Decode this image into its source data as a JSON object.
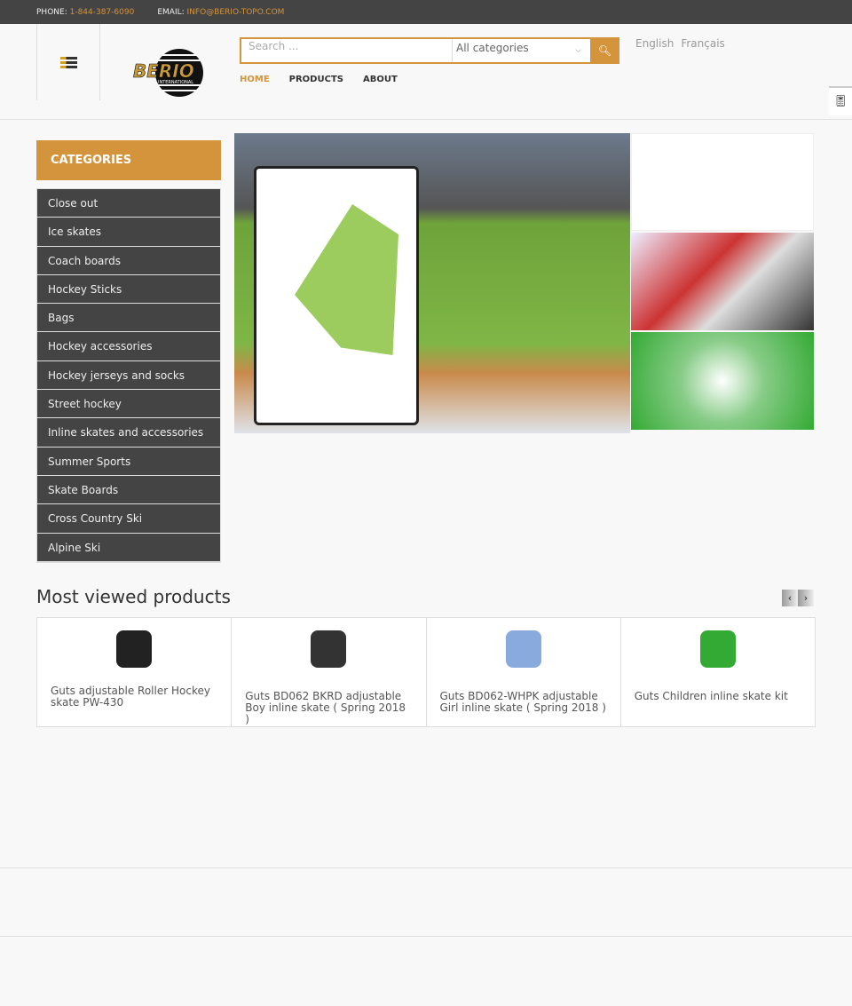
{
  "topbar": {
    "phone_label": "PHONE:",
    "phone": "1-844-387-6090",
    "email_label": "EMAIL:",
    "email": "INFO@BERIO-TOPO.COM"
  },
  "logo": {
    "text": "BERIO",
    "sub": "INTERNATIONAL"
  },
  "search": {
    "placeholder": "Search ...",
    "category": "All categories"
  },
  "languages": [
    "English",
    "Français"
  ],
  "nav": [
    "HOME",
    "PRODUCTS",
    "ABOUT"
  ],
  "categories": {
    "title": "CATEGORIES",
    "items": [
      "Close out",
      "Ice skates",
      "Coach boards",
      "Hockey Sticks",
      "Bags",
      "Hockey accessories",
      "Hockey jerseys and socks",
      "Street hockey",
      "Inline skates and accessories",
      "Summer Sports",
      "Skate Boards",
      "Cross Country Ski",
      "Alpine Ski"
    ]
  },
  "most_viewed": {
    "title": "Most viewed products",
    "products": [
      {
        "name": "Guts adjustable Roller Hockey skate PW-430",
        "color": "#222"
      },
      {
        "name": "Guts BD062 BKRD adjustable Boy inline skate ( Spring 2018 )",
        "color": "#333"
      },
      {
        "name": "Guts BD062-WHPK adjustable Girl inline skate ( Spring 2018 )",
        "color": "#8ad"
      },
      {
        "name": "Guts Children inline skate kit",
        "color": "#3a3"
      }
    ]
  },
  "colors": {
    "accent": "#d4943c",
    "dark": "#444444"
  }
}
